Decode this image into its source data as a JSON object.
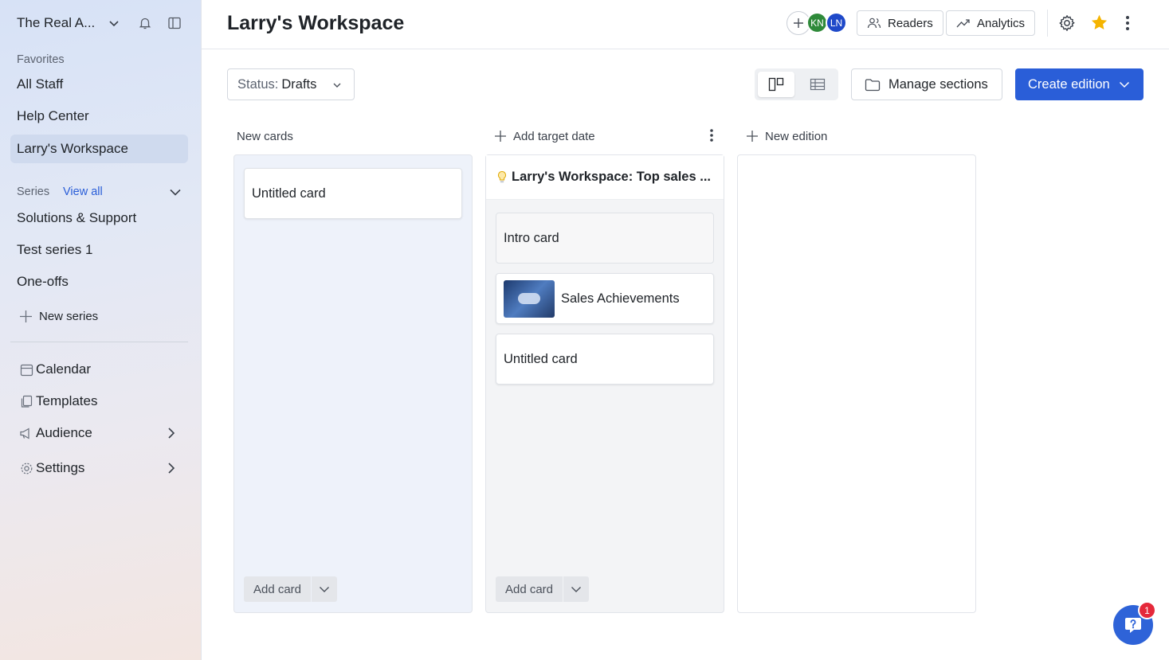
{
  "sidebar": {
    "workspace_name": "The Real A...",
    "favorites_label": "Favorites",
    "favorites": [
      "All Staff",
      "Help Center",
      "Larry's Workspace"
    ],
    "series_label": "Series",
    "view_all": "View all",
    "series": [
      "Solutions & Support",
      "Test series 1",
      "One-offs"
    ],
    "new_series": "New series",
    "nav": [
      "Calendar",
      "Templates",
      "Audience",
      "Settings"
    ]
  },
  "header": {
    "title": "Larry's Workspace",
    "avatars": [
      {
        "initials": "KN",
        "color": "#2f8a3a"
      },
      {
        "initials": "LN",
        "color": "#1f49c9"
      }
    ],
    "readers": "Readers",
    "analytics": "Analytics"
  },
  "toolbar": {
    "status_key": "Status:",
    "status_value": "Drafts",
    "manage_sections": "Manage sections",
    "create_edition": "Create edition"
  },
  "board": {
    "col1": {
      "header": "New cards",
      "cards": [
        "Untitled card"
      ],
      "add_card": "Add card"
    },
    "col2": {
      "header": "Add target date",
      "edition_title": "Larry's Workspace: Top sales ...",
      "cards": [
        "Intro card",
        "Sales Achievements",
        "Untitled card"
      ],
      "add_card": "Add card"
    },
    "col3": {
      "header": "New edition"
    }
  },
  "help": {
    "badge": "1"
  },
  "colors": {
    "accent": "#2a5ed8",
    "active_nav": "#cfdaee",
    "star": "#f5b400"
  }
}
